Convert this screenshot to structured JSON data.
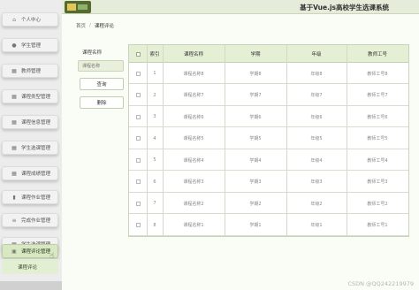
{
  "header": {
    "title": "基于Vue.js高校学生选课系统"
  },
  "sidebar": {
    "items": [
      {
        "label": "个人中心",
        "icon": "home-icon"
      },
      {
        "label": "学生管理",
        "icon": "user-icon"
      },
      {
        "label": "教师管理",
        "icon": "grid-icon"
      },
      {
        "label": "课程类型管理",
        "icon": "grid-icon"
      },
      {
        "label": "课程信息管理",
        "icon": "grid-icon"
      },
      {
        "label": "学生选课管理",
        "icon": "grid-icon"
      },
      {
        "label": "课程成绩管理",
        "icon": "grid-icon"
      },
      {
        "label": "课程作业管理",
        "icon": "chart-icon"
      },
      {
        "label": "完成作业管理",
        "icon": "list-icon"
      },
      {
        "label": "学生选课管理",
        "icon": "grid-icon"
      },
      {
        "label": "课程评论管理",
        "icon": "doc-icon"
      }
    ],
    "active_index": 10,
    "sub_item": {
      "label": "课程评论"
    }
  },
  "breadcrumb": {
    "home": "首页",
    "separator": "/",
    "current": "课程评论"
  },
  "search": {
    "label": "课程名称",
    "placeholder": "课程名称",
    "query_button": "查询",
    "delete_button": "删除"
  },
  "table": {
    "columns": [
      "索引",
      "课程名称",
      "学期",
      "年级",
      "教师工号"
    ],
    "rows": [
      {
        "index": "1",
        "course": "课程名称8",
        "term": "学期8",
        "grade": "年级8",
        "teacher": "教师工号8"
      },
      {
        "index": "2",
        "course": "课程名称7",
        "term": "学期7",
        "grade": "年级7",
        "teacher": "教师工号7"
      },
      {
        "index": "3",
        "course": "课程名称6",
        "term": "学期6",
        "grade": "年级6",
        "teacher": "教师工号6"
      },
      {
        "index": "4",
        "course": "课程名称5",
        "term": "学期5",
        "grade": "年级5",
        "teacher": "教师工号5"
      },
      {
        "index": "5",
        "course": "课程名称4",
        "term": "学期4",
        "grade": "年级4",
        "teacher": "教师工号4"
      },
      {
        "index": "6",
        "course": "课程名称3",
        "term": "学期3",
        "grade": "年级3",
        "teacher": "教师工号3"
      },
      {
        "index": "7",
        "course": "课程名称2",
        "term": "学期2",
        "grade": "年级2",
        "teacher": "教师工号2"
      },
      {
        "index": "8",
        "course": "课程名称1",
        "term": "学期1",
        "grade": "年级1",
        "teacher": "教师工号1"
      }
    ]
  },
  "watermark": "CSDN @QQ242219979",
  "colors": {
    "accent": "#d8e8c2",
    "header_bg": "#e5ecd9",
    "table_head": "#e4efd3"
  }
}
